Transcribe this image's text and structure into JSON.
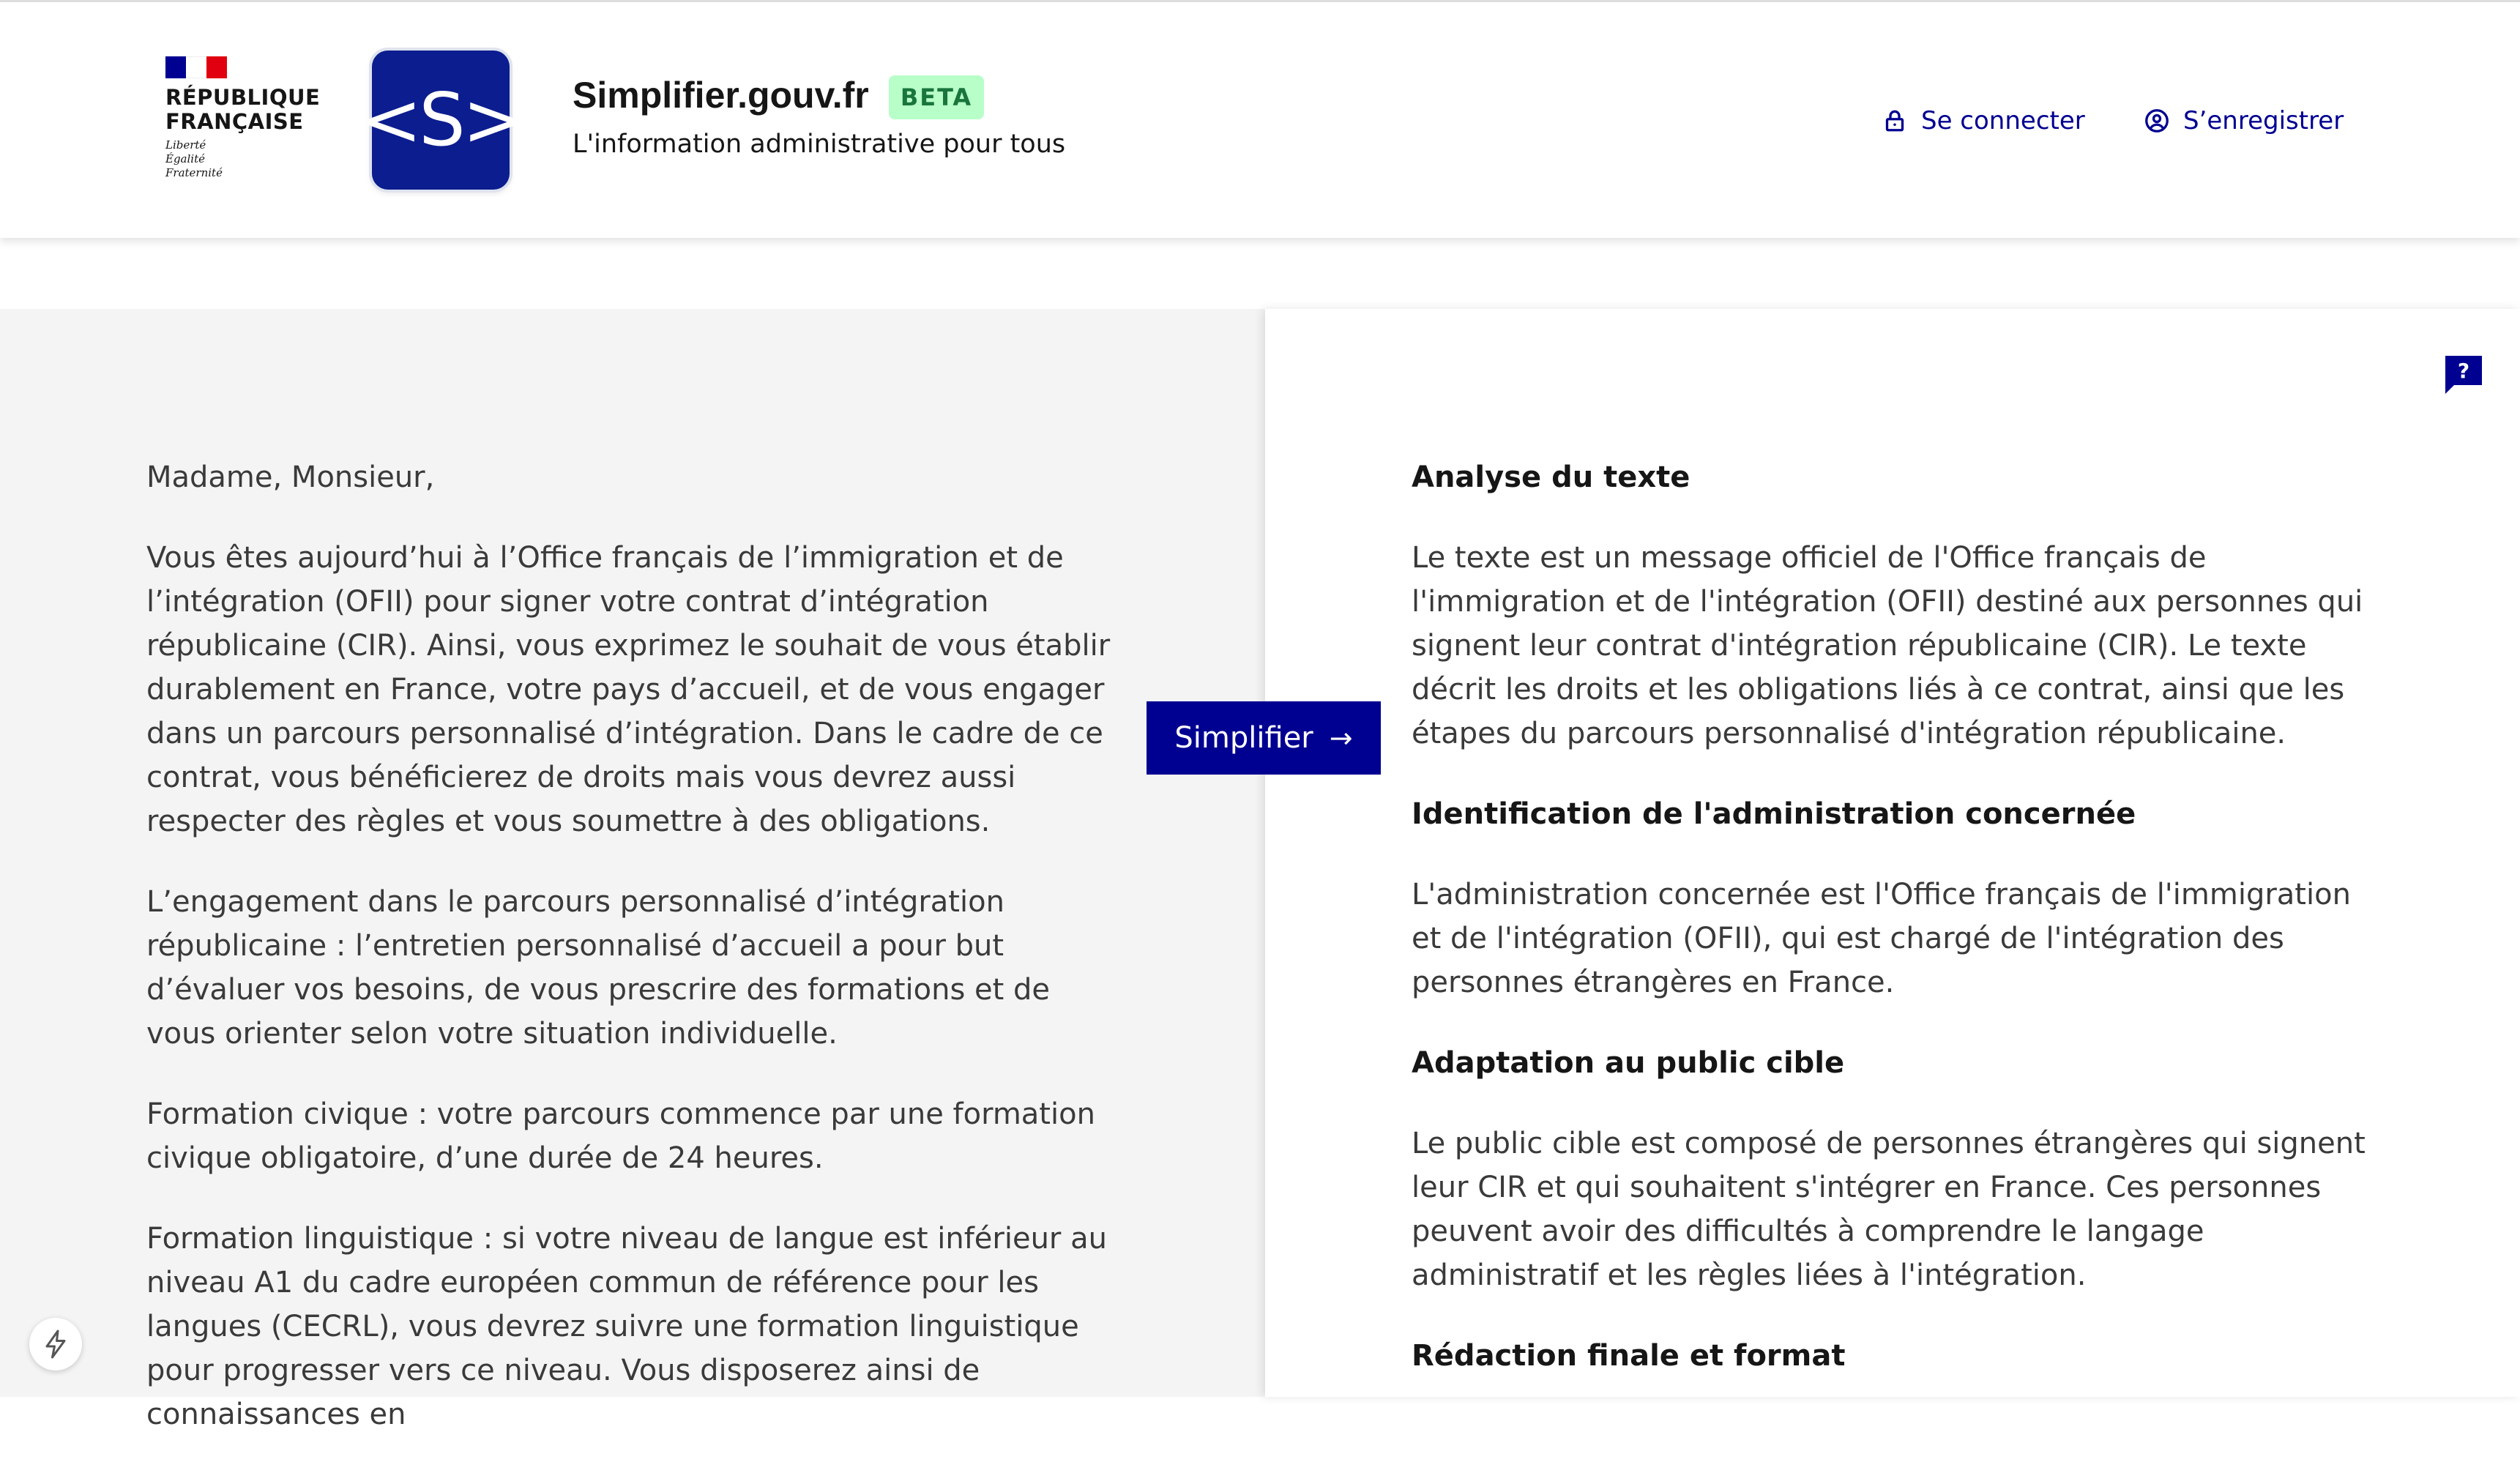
{
  "header": {
    "republic_logo": {
      "name_line1": "RÉPUBLIQUE",
      "name_line2": "FRANÇAISE",
      "motto_line1": "Liberté",
      "motto_line2": "Égalité",
      "motto_line3": "Fraternité",
      "flag_colors": [
        "#000091",
        "#ffffff",
        "#e1000f"
      ]
    },
    "app_logo_text": "<S>",
    "site_title": "Simplifier.gouv.fr",
    "badge": "BETA",
    "tagline": "L'information administrative pour tous",
    "links": {
      "login": {
        "label": "Se connecter",
        "icon": "lock-icon"
      },
      "register": {
        "label": "S’enregistrer",
        "icon": "user-circle-icon"
      }
    }
  },
  "input_text": [
    "Madame, Monsieur,",
    "Vous êtes aujourd’hui à l’Office français de l’immigration et de l’intégration (OFII) pour signer votre contrat d’intégration républicaine (CIR). Ainsi, vous exprimez le souhait de vous établir durablement en France, votre pays d’accueil, et de vous engager dans un parcours personnalisé d’intégration. Dans le cadre de ce contrat, vous bénéficierez de droits mais vous devrez aussi respecter des règles et vous soumettre à des obligations.",
    "L’engagement dans le parcours personnalisé d’intégration républicaine  : l’entretien personnalisé d’accueil a pour but d’évaluer vos besoins, de vous prescrire des formations et de vous orienter selon votre situation individuelle.",
    "Formation civique : votre parcours commence par une formation civique obligatoire, d’une durée de 24 heures.",
    "Formation linguistique : si votre niveau de langue est inférieur au niveau A1 du cadre européen commun de référence pour les langues (CECRL), vous devrez suivre une formation linguistique pour progresser vers ce niveau. Vous disposerez ainsi de connaissances en"
  ],
  "simplify_button": {
    "label": "Simplifier",
    "arrow": "→"
  },
  "help_button": {
    "label": "?",
    "icon": "help-bubble-icon"
  },
  "result": {
    "sections": [
      {
        "title": "Analyse du texte",
        "body": "Le texte est un message officiel de l'Office français de l'immigration et de l'intégration (OFII) destiné aux personnes qui signent leur contrat d'intégration républicaine (CIR). Le texte décrit les droits et les obligations liés à ce contrat, ainsi que les étapes du parcours personnalisé d'intégration républicaine."
      },
      {
        "title": "Identification de l'administration concernée",
        "body": "L'administration concernée est l'Office français de l'immigration et de l'intégration (OFII), qui est chargé de l'intégration des personnes étrangères en France."
      },
      {
        "title": "Adaptation au public cible",
        "body": "Le public cible est composé de personnes étrangères qui signent leur CIR et qui souhaitent s'intégrer en France. Ces personnes peuvent avoir des difficultés à comprendre le langage administratif et les règles liées à l'intégration."
      },
      {
        "title": "Rédaction finale et format",
        "body": ""
      }
    ]
  },
  "floating_action": {
    "icon": "lightning-icon"
  },
  "colors": {
    "primary": "#000091",
    "badge_bg": "#b8fec9",
    "badge_text": "#18753c",
    "left_panel_bg": "#f4f4f4",
    "logo_bg": "#0c1d8f"
  }
}
